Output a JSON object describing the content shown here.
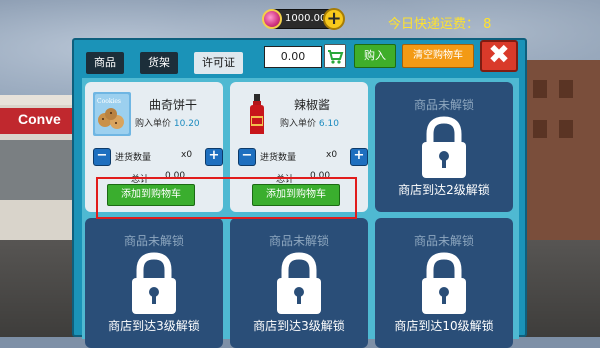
{
  "hud": {
    "coins": "1000.00",
    "coin_plus": "+",
    "delivery_fee": "今日快递运费： 8"
  },
  "tabs": [
    {
      "label": "商品"
    },
    {
      "label": "货架"
    },
    {
      "label": "许可证"
    }
  ],
  "toolbar": {
    "cart_total": "0.00",
    "buy_label": "购入",
    "clear_label": "清空购物车",
    "close_glyph": "✖"
  },
  "items": [
    {
      "name": "曲奇饼干",
      "thumb_text": "Cookies",
      "unit_label": "购入单价",
      "unit_price": "10.20",
      "qty_label": "进货数量",
      "qty_value": "x0",
      "total_label": "总计",
      "total_value": "0.00",
      "add_label": "添加到购物车",
      "minus": "−",
      "plus": "+"
    },
    {
      "name": "辣椒酱",
      "unit_label": "购入单价",
      "unit_price": "6.10",
      "qty_label": "进货数量",
      "qty_value": "x0",
      "total_label": "总计",
      "total_value": "0.00",
      "add_label": "添加到购物车",
      "minus": "−",
      "plus": "+"
    }
  ],
  "locked": [
    {
      "title": "商品未解锁",
      "note": "商店到达2级解锁"
    },
    {
      "title": "商品未解锁",
      "note": "商店到达3级解锁"
    },
    {
      "title": "商品未解锁",
      "note": "商店到达3级解锁"
    },
    {
      "title": "商品未解锁",
      "note": "商店到达10级解锁"
    }
  ],
  "scene": {
    "store_sign": "Conve"
  },
  "colors": {
    "panel": "#1b93b8",
    "locked_card": "#2a4e78",
    "add_button": "#3aae2e",
    "clear_button": "#f39a15",
    "close_button": "#d93a2a",
    "highlight": "#e11c1c",
    "fee_text": "#ffe22e"
  }
}
